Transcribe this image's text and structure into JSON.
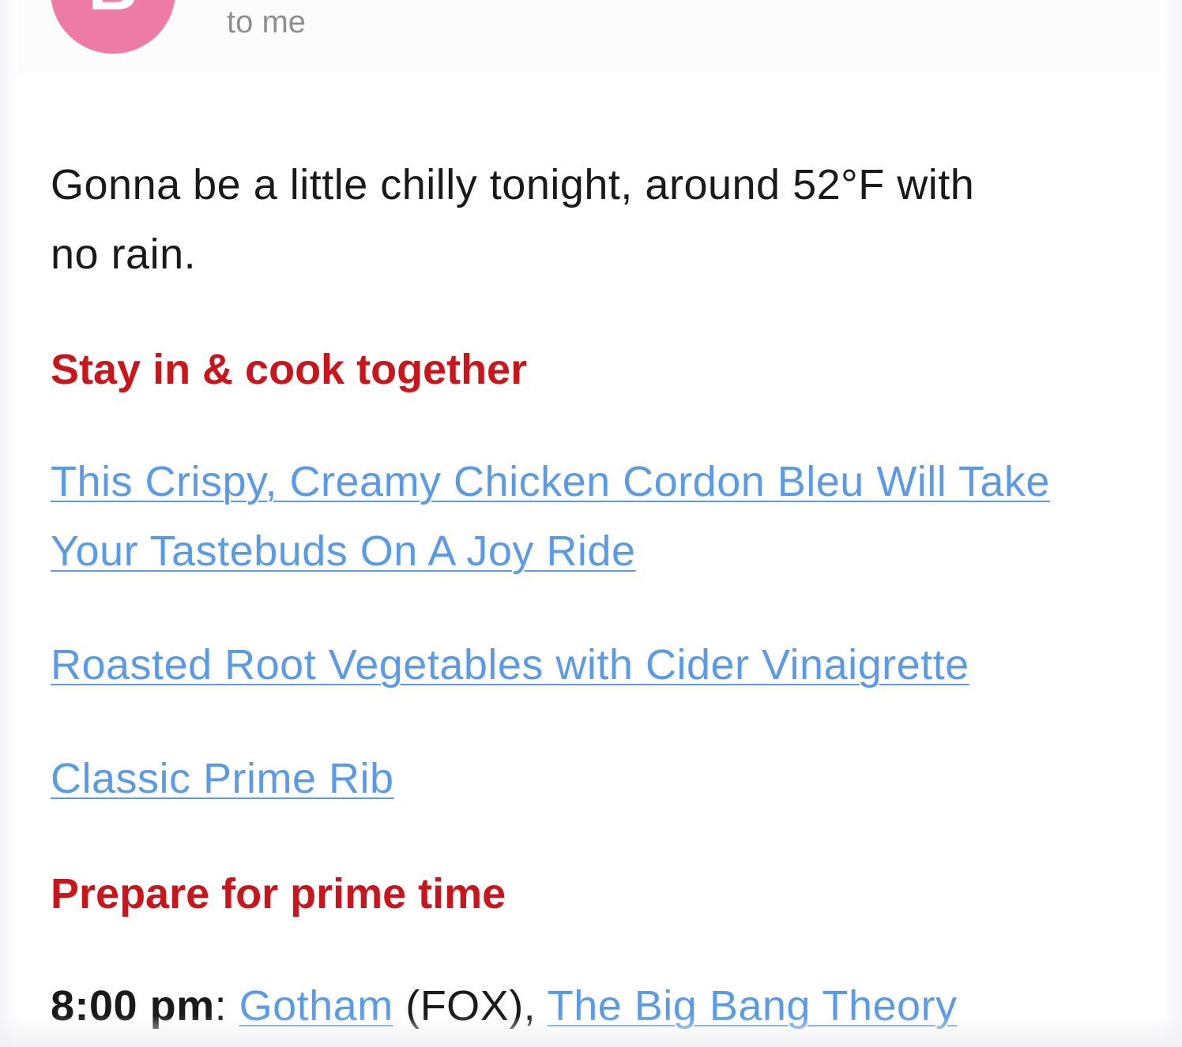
{
  "header": {
    "avatar_initial": "B",
    "recipient_text": "to me"
  },
  "message": {
    "intro_line1": "Gonna be a little chilly tonight, around 52°F with",
    "intro_line2": "no rain.",
    "section_cook": {
      "heading": "Stay in & cook together",
      "links": [
        "This Crispy, Creamy Chicken Cordon Bleu Will Take Your Tastebuds On A Joy Ride",
        "Roasted Root Vegetables with Cider Vinaigrette",
        "Classic Prime Rib"
      ]
    },
    "section_tv": {
      "heading": "Prepare for prime time",
      "schedule": {
        "time": "8:00 pm",
        "colon": ": ",
        "show1": "Gotham",
        "network1": " (FOX), ",
        "show2": "The Big Bang Theory"
      }
    }
  },
  "colors": {
    "avatar": "#ee7aa6",
    "heading": "#c8161d",
    "link": "#5b9be6",
    "muted": "#8e8e93",
    "text": "#1a1a1a"
  }
}
